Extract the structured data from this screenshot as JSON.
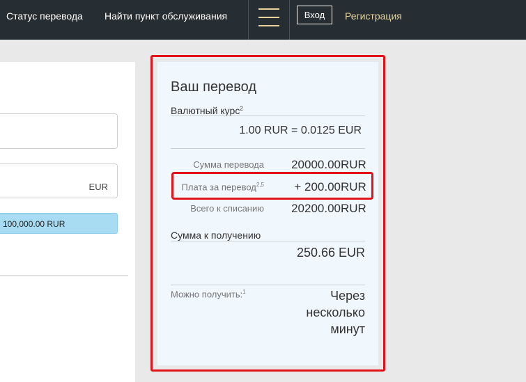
{
  "nav": {
    "transfer_status": "Статус перевода",
    "find_location": "Найти пункт обслуживания",
    "login": "Вход",
    "register": "Регистрация"
  },
  "form": {
    "receive_currency": "EUR",
    "limit_text": "100,000.00 RUR"
  },
  "summary": {
    "title": "Ваш перевод",
    "rate_label": "Валютный курс",
    "rate_note": "2",
    "rate_value": "1.00 RUR = 0.0125 EUR",
    "amount_label": "Сумма перевода",
    "amount_value": "20000.00",
    "amount_currency": "RUR",
    "fee_label": "Плата за перевод",
    "fee_note": "2,5",
    "fee_value": "+ 200.00",
    "fee_currency": "RUR",
    "total_label": "Всего к списанию",
    "total_value": "20200.00",
    "total_currency": "RUR",
    "receive_label": "Сумма к получению",
    "receive_value": "250.66 EUR",
    "available_label": "Можно получить:",
    "available_note": "1",
    "available_time": "Через несколько минут"
  },
  "colors": {
    "topbar": "#272e33",
    "accent_gold": "#e8d49a",
    "highlight_red": "#e2121b",
    "limit_blue": "#a7dcf3",
    "summary_bg": "#f0f7fd"
  },
  "icons": {
    "menu": "hamburger-menu-icon"
  }
}
